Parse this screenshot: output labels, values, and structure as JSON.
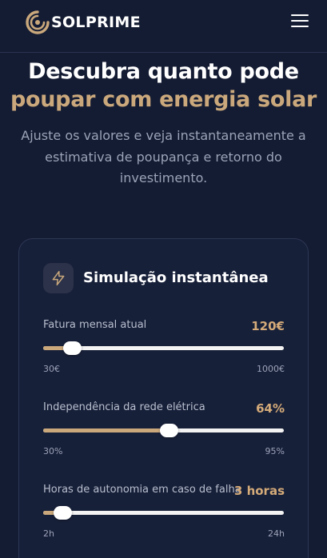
{
  "brand": {
    "name": "SOLPRIME"
  },
  "header": {
    "menu_icon": "hamburger-menu-icon"
  },
  "hero": {
    "title_line1": "Descubra quanto pode",
    "title_line2": "poupar com energia solar",
    "subtitle_line1": "Ajuste os valores e veja instantaneamente a",
    "subtitle_line2": "estimativa de poupança e retorno do",
    "subtitle_line3": "investimento."
  },
  "card": {
    "title": "Simulação instantânea",
    "icon": "lightning-bolt-icon",
    "sliders": [
      {
        "label": "Fatura mensal atual",
        "value": "120€",
        "min": "30€",
        "max": "1000€",
        "fraction": 0.12
      },
      {
        "label": "Independência da rede elétrica",
        "value": "64%",
        "min": "30%",
        "max": "95%",
        "fraction": 0.52
      },
      {
        "label": "Horas de autonomia em caso de falha",
        "value": "3 horas",
        "min": "2h",
        "max": "24h",
        "fraction": 0.08
      }
    ]
  },
  "colors": {
    "background": "#141c33",
    "accent_gold": "#caa87c",
    "text_muted": "#9ba3b8"
  }
}
